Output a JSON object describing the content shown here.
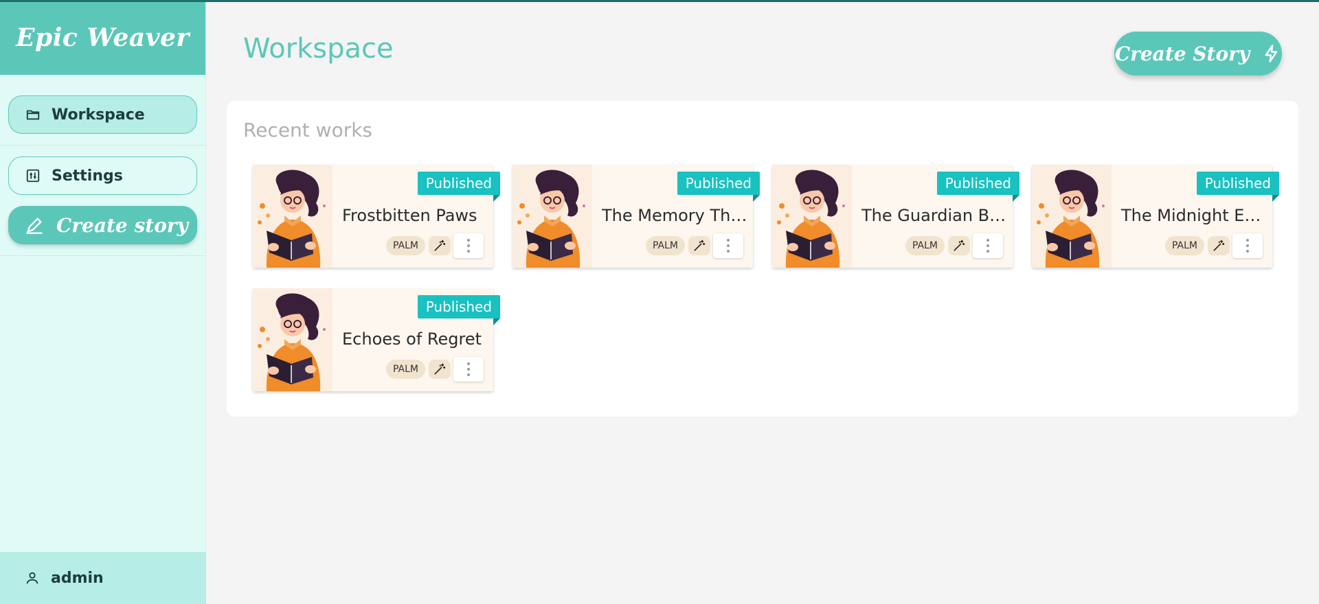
{
  "app": {
    "brand": "Epic Weaver"
  },
  "sidebar": {
    "items": [
      {
        "label": "Workspace",
        "icon": "folder-icon",
        "active": true
      },
      {
        "label": "Settings",
        "icon": "sliders-icon",
        "active": false
      }
    ],
    "create_label": "Create story",
    "user": "admin"
  },
  "header": {
    "title": "Workspace",
    "create_label": "Create Story"
  },
  "recent": {
    "title": "Recent works",
    "cards": [
      {
        "title": "Frostbitten Paws",
        "status": "Published",
        "model": "PALM"
      },
      {
        "title": "The Memory Thief",
        "status": "Published",
        "model": "PALM"
      },
      {
        "title": "The Guardian Be...",
        "status": "Published",
        "model": "PALM"
      },
      {
        "title": "The Midnight Ec...",
        "status": "Published",
        "model": "PALM"
      },
      {
        "title": "Echoes of Regret",
        "status": "Published",
        "model": "PALM"
      }
    ]
  },
  "colors": {
    "accent": "#5bc7b8",
    "badge": "#19c1c1",
    "sidebar_bg": "#e0fbf6"
  }
}
